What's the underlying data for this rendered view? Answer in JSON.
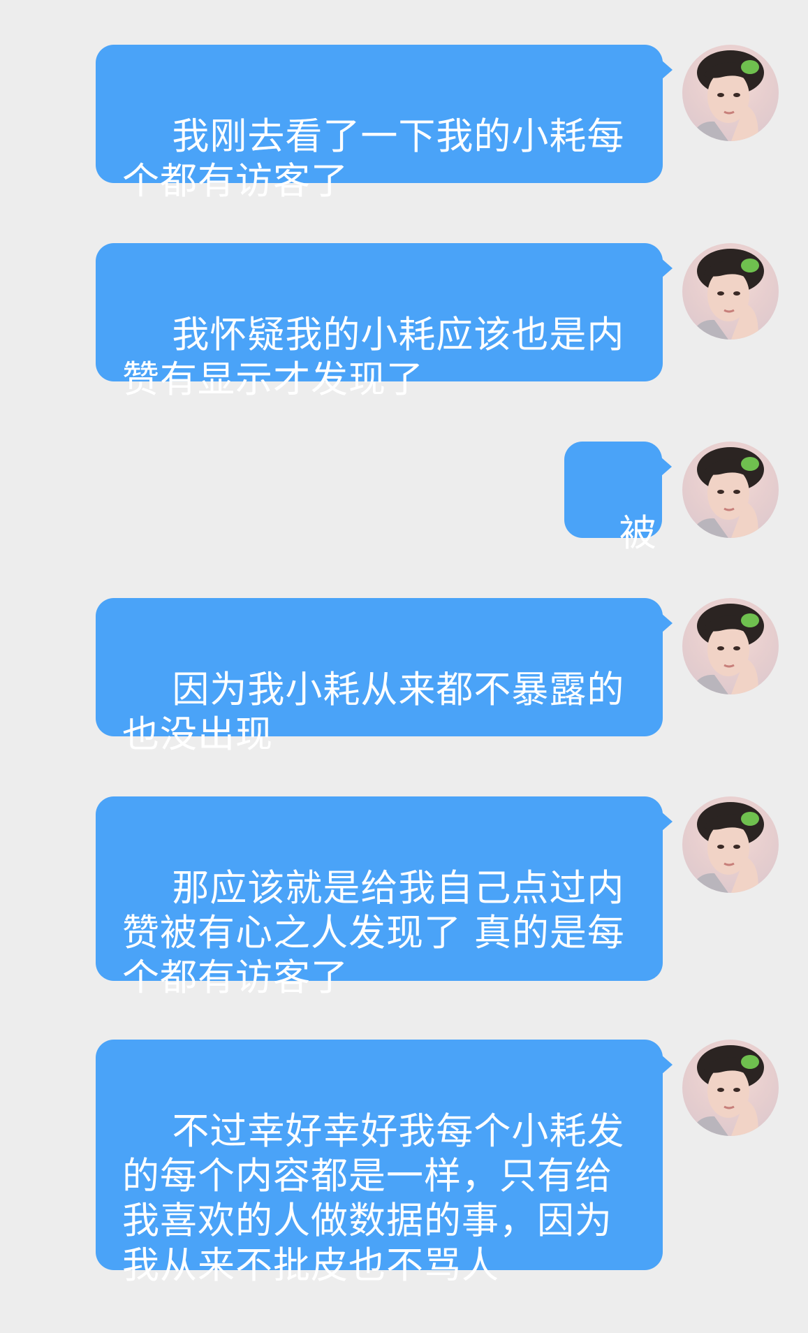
{
  "messages": [
    {
      "text": "我刚去看了一下我的小耗每个都有访客了"
    },
    {
      "text": "我怀疑我的小耗应该也是内赞有显示才发现了"
    },
    {
      "text": "被"
    },
    {
      "text": "因为我小耗从来都不暴露的\n也没出现"
    },
    {
      "text": "那应该就是给我自己点过内赞被有心之人发现了 真的是每个都有访客了"
    },
    {
      "text": "不过幸好幸好我每个小耗发的每个内容都是一样，只有给我喜欢的人做数据的事，因为我从来不批皮也不骂人"
    }
  ]
}
